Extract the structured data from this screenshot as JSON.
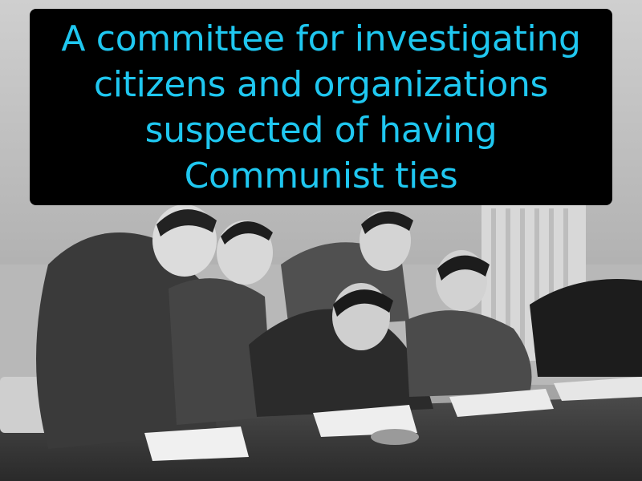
{
  "caption": {
    "text": "A committee for investigating citizens and organizations suspected of having Communist ties",
    "text_color": "#1fc7f0",
    "background_color": "#000000"
  },
  "photo": {
    "style": "black-and-white photograph",
    "scene": "Five men in suits gathered at a table, one seated man writing on papers while others look on"
  }
}
